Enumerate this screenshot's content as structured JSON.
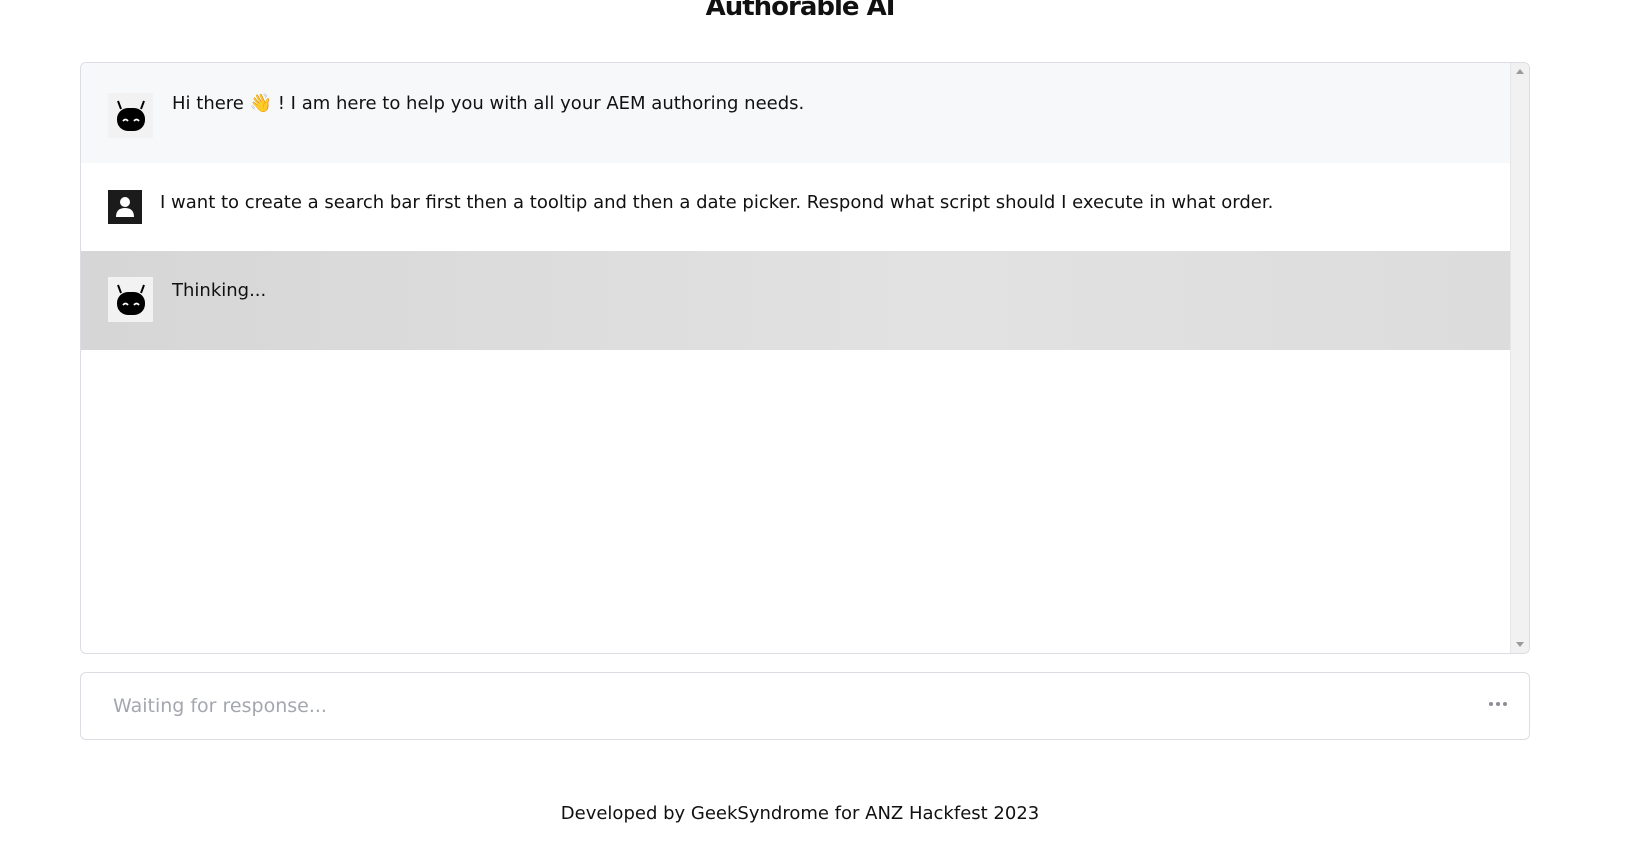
{
  "header": {
    "title": "Authorable AI"
  },
  "chat": {
    "messages": [
      {
        "role": "bot",
        "text": "Hi there 👋 ! I am here to help you with all your AEM authoring needs."
      },
      {
        "role": "user",
        "text": "I want to create a search bar first then a tooltip and then a date picker. Respond what script should I execute in what order."
      },
      {
        "role": "bot",
        "text": "Thinking..."
      }
    ]
  },
  "input": {
    "placeholder": "Waiting for response...",
    "value": ""
  },
  "icons": {
    "bot_avatar": "robot-icon",
    "user_avatar": "user-icon",
    "more": "more-dots-icon"
  },
  "footer": {
    "text": "Developed by GeekSyndrome for ANZ Hackfest 2023"
  }
}
